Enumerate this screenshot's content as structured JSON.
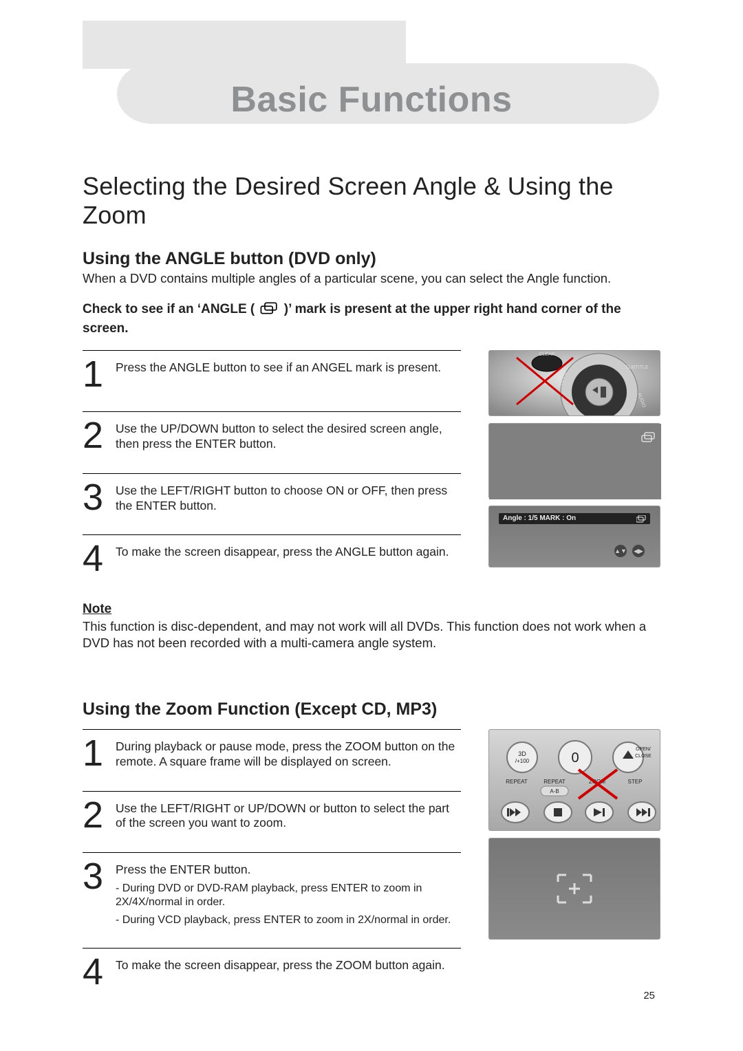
{
  "chapter_title": "Basic Functions",
  "section_title": "Selecting the Desired Screen Angle & Using the Zoom",
  "angle": {
    "heading": "Using the ANGLE button (DVD only)",
    "intro": "When a DVD contains multiple angles of a particular scene, you can select the Angle function.",
    "check_pre": "Check to see if an ‘ANGLE ( ",
    "check_post": " )’ mark is present at the upper right hand corner of the screen.",
    "steps": [
      "Press the ANGLE button to see if an ANGEL mark is present.",
      "Use the UP/DOWN button to select the desired screen angle, then press the ENTER button.",
      "Use the LEFT/RIGHT button to choose ON or OFF, then press the ENTER button.",
      "To make the screen disappear, press the ANGLE button again."
    ],
    "osd_text": "Angle : 1/5    MARK : On",
    "note_heading": "Note",
    "note_body": "This function is disc-dependent, and may not work will all DVDs. This function does not work when a DVD has not been recorded with a multi-camera angle system."
  },
  "zoom": {
    "heading": "Using the Zoom Function (Except CD, MP3)",
    "steps": [
      {
        "text": "During playback or pause mode, press the ZOOM button on the remote. A square frame will be displayed on screen.",
        "sub": []
      },
      {
        "text": "Use the LEFT/RIGHT or UP/DOWN or button to select the part of the screen you want to zoom.",
        "sub": []
      },
      {
        "text": "Press the ENTER button.",
        "sub": [
          "- During DVD or DVD-RAM  playback, press ENTER to zoom in 2X/4X/normal  in order.",
          "- During VCD playback, press ENTER to zoom in 2X/normal  in order."
        ]
      },
      {
        "text": "To make the screen disappear, press the ZOOM button again.",
        "sub": []
      }
    ],
    "remote_labels": {
      "threeD": "3D\n/+100",
      "zero": "0",
      "open": "OPEN/\nCLOSE",
      "repeat": "REPEAT",
      "repeat_ab": "REPEAT\nA-B",
      "zoom": "ZOOM",
      "step": "STEP"
    }
  },
  "remote_top_labels": {
    "clear": "CLEAR",
    "subtitle": "SUBTITLE",
    "audio": "AUDIO",
    "angle": "ANGLE"
  },
  "page_number": "25"
}
